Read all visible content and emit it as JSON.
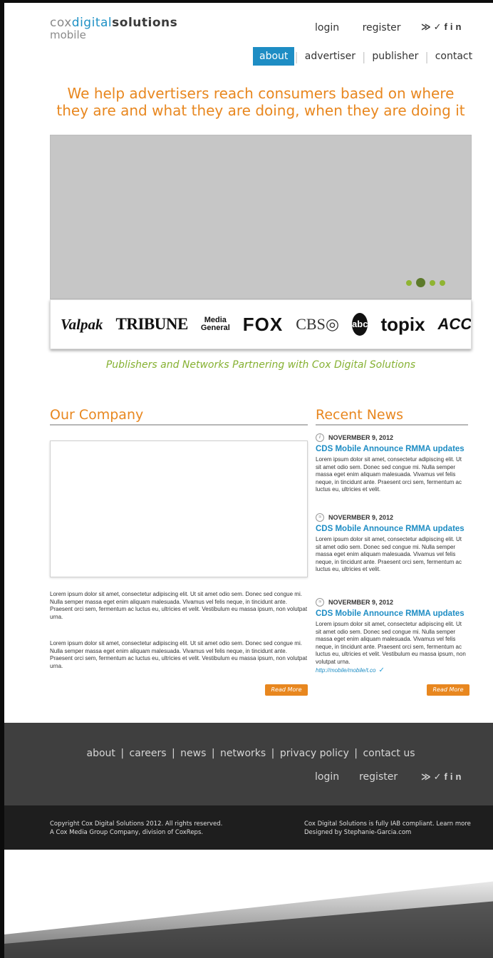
{
  "brand": {
    "cox": "cox",
    "digital": "digital",
    "solutions": "solutions",
    "sub": "mobile"
  },
  "top_links": {
    "login": "login",
    "register": "register"
  },
  "social": {
    "rss_icon": "rss-icon",
    "twitter_icon": "twitter-icon",
    "facebook_icon": "facebook-icon",
    "linkedin_icon": "linkedin-icon",
    "glyphs": "☃"
  },
  "nav": {
    "about": "about",
    "advertiser": "advertiser",
    "publisher": "publisher",
    "contact": "contact"
  },
  "headline": "We help advertisers reach consumers based on where they are and what they are doing, when they are doing it",
  "partner_logos": {
    "valpak": "Valpak",
    "tribune": "TRIBUNE",
    "media1": "Media",
    "media2": "General",
    "fox": "FOX",
    "cbs": "CBS◎",
    "abc": "abc",
    "topix": "topix",
    "accu": "ACCU"
  },
  "partners_caption": "Publishers and Networks Partnering with Cox Digital Solutions",
  "company": {
    "title": "Our Company",
    "para1": "Lorem ipsum dolor sit amet, consectetur adipiscing elit. Ut sit amet odio sem. Donec sed congue mi. Nulla semper massa eget enim aliquam malesuada. Vivamus vel felis neque, in tincidunt ante. Praesent orci sem, fermentum ac luctus eu, ultricies et velit. Vestibulum eu massa ipsum, non volutpat urna.",
    "para2": "Lorem ipsum dolor sit amet, consectetur adipiscing elit. Ut sit amet odio sem. Donec sed congue mi. Nulla semper massa eget enim aliquam malesuada. Vivamus vel felis neque, in tincidunt ante. Praesent orci sem, fermentum ac luctus eu, ultricies et velit. Vestibulum eu massa ipsum, non volutpat urna.",
    "read_more": "Read More"
  },
  "news": {
    "title": "Recent News",
    "items": [
      {
        "date": "NOVERMBER 9, 2012",
        "title": "CDS Mobile Announce RMMA updates",
        "body": "Lorem ipsum dolor sit amet, consectetur adipiscing elit. Ut sit amet odio sem. Donec sed congue mi. Nulla semper massa eget enim aliquam malesuada. Vivamus vel felis neque, in tincidunt ante. Praesent orci sem, fermentum ac luctus eu, ultricies et velit.",
        "icon": "i"
      },
      {
        "date": "NOVERMBER 9, 2012",
        "title": "CDS Mobile Announce RMMA updates",
        "body": "Lorem ipsum dolor sit amet, consectetur adipiscing elit. Ut sit amet odio sem. Donec sed congue mi. Nulla semper massa eget enim aliquam malesuada. Vivamus vel felis neque, in tincidunt ante. Praesent orci sem, fermentum ac luctus eu, ultricies et velit.",
        "icon": "≈"
      },
      {
        "date": "NOVERMBER 9, 2012",
        "title": "CDS Mobile Announce RMMA updates",
        "body": "Lorem ipsum dolor sit amet, consectetur adipiscing elit. Ut sit amet odio sem. Donec sed congue mi. Nulla semper massa eget enim aliquam malesuada. Vivamus vel felis neque, in tincidunt ante. Praesent orci sem, fermentum ac luctus eu, ultricies et velit. Vestibulum eu massa ipsum, non volutpat urna.",
        "icon": "≈",
        "link": "http://mobile/mobile/t.co"
      }
    ],
    "read_more": "Read More"
  },
  "footer": {
    "nav": [
      "about",
      "careers",
      "news",
      "networks",
      "privacy policy",
      "contact us"
    ],
    "login": "login",
    "register": "register"
  },
  "copyright": {
    "left1": "Copyright Cox Digital Solutions 2012. All rights reserved.",
    "left2": "A Cox Media Group Company, division of CoxReps.",
    "right1": "Cox Digital Solutions is fully IAB compliant. Learn more",
    "right2": "Designed by Stephanie-Garcia.com"
  }
}
